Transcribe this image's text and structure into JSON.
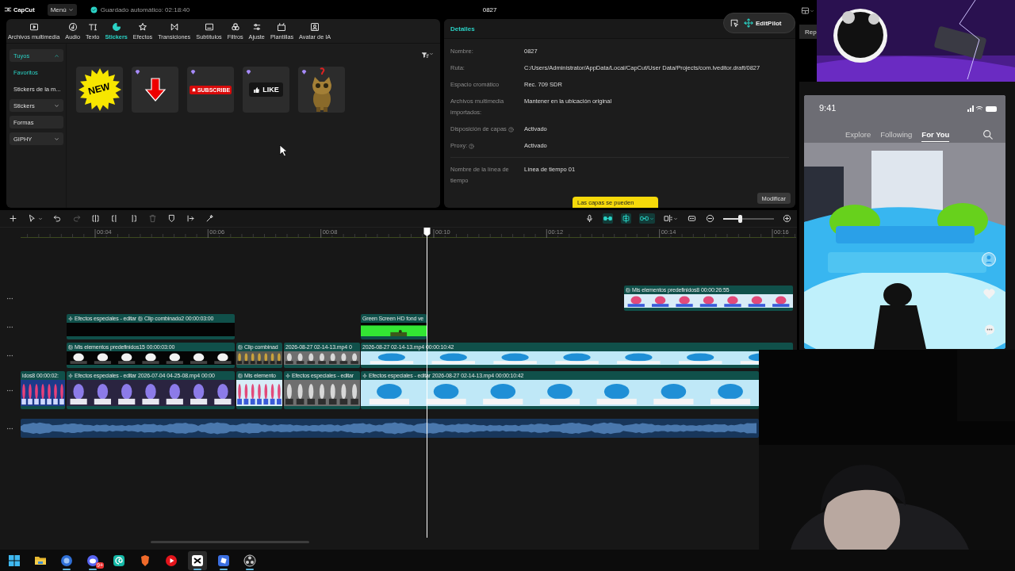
{
  "app": {
    "logo": "CapCut",
    "menu": "Menú",
    "autosave": "Guardado automático: 02:18:40",
    "title": "0827"
  },
  "tabs": [
    {
      "label": "Archivos multimedia",
      "selected": false
    },
    {
      "label": "Audio",
      "selected": false
    },
    {
      "label": "Texto",
      "selected": false
    },
    {
      "label": "Stickers",
      "selected": true
    },
    {
      "label": "Efectos",
      "selected": false
    },
    {
      "label": "Transiciones",
      "selected": false
    },
    {
      "label": "Subtítulos",
      "selected": false
    },
    {
      "label": "Filtros",
      "selected": false
    },
    {
      "label": "Ajuste",
      "selected": false
    },
    {
      "label": "Plantillas",
      "selected": false
    },
    {
      "label": "Avatar de IA",
      "selected": false
    }
  ],
  "sidebar": {
    "items": [
      {
        "kind": "group",
        "label": "Tuyos",
        "selected": true,
        "expanded": true,
        "children": [
          {
            "label": "Favoritos",
            "selected": true
          },
          {
            "label": "Stickers de la m...",
            "selected": false
          }
        ]
      },
      {
        "kind": "group",
        "label": "Stickers",
        "selected": false,
        "expanded": false
      },
      {
        "kind": "plain",
        "label": "Formas",
        "selected": false
      },
      {
        "kind": "group",
        "label": "GIPHY",
        "selected": false,
        "expanded": false
      }
    ]
  },
  "stickers": [
    {
      "kind": "new",
      "text": "NEW",
      "premium": false
    },
    {
      "kind": "arrow",
      "premium": true
    },
    {
      "kind": "subscribe",
      "text": "SUBSCRIBE",
      "premium": true
    },
    {
      "kind": "like",
      "text": "LIKE",
      "premium": true
    },
    {
      "kind": "cat",
      "premium": true
    }
  ],
  "details": {
    "title": "Detalles",
    "rows": [
      {
        "label": "Nombre:",
        "value": "0827",
        "help": false
      },
      {
        "label": "Ruta:",
        "value": "C:/Users/Administrator/AppData/Local/CapCut/User Data/Projects/com.lveditor.draft/0827",
        "help": false
      },
      {
        "label": "Espacio cromático",
        "value": "Rec. 709 SDR",
        "help": false
      },
      {
        "label": "Archivos multimedia importados:",
        "value": "Mantener en la ubicación original",
        "help": false
      },
      {
        "label": "Disposición de capas",
        "value": "Activado",
        "help": true
      },
      {
        "label": "Proxy:",
        "value": "Activado",
        "help": true
      }
    ],
    "timeline_rows": [
      {
        "label": "Nombre de la línea de tiempo",
        "value": "Línea de tiempo 01",
        "help": false
      }
    ],
    "button": "Modificar",
    "tooltip": "Las capas se pueden"
  },
  "editpilot": {
    "label": "EditPilot"
  },
  "timeline": {
    "tools": [
      {
        "kind": "add",
        "disabled": false
      },
      {
        "kind": "select",
        "disabled": false
      },
      {
        "kind": "undo",
        "disabled": false
      },
      {
        "kind": "redo",
        "disabled": true
      },
      {
        "kind": "split",
        "disabled": false
      },
      {
        "kind": "trim-left",
        "disabled": false
      },
      {
        "kind": "trim-right",
        "disabled": false
      },
      {
        "kind": "delete",
        "disabled": true
      },
      {
        "kind": "marker",
        "disabled": false
      },
      {
        "kind": "freeze",
        "disabled": false
      },
      {
        "kind": "auto",
        "disabled": false
      }
    ],
    "view_tools": [
      {
        "kind": "record",
        "on": false
      },
      {
        "kind": "link",
        "on": true
      },
      {
        "kind": "snap",
        "on": true
      },
      {
        "kind": "linkage",
        "on": true
      },
      {
        "kind": "preview",
        "on": false
      },
      {
        "kind": "captions",
        "on": false
      }
    ],
    "zoom": {
      "level": 0.33
    },
    "ruler": [
      "00:04",
      "00:06",
      "00:08",
      "00:10",
      "00:12",
      "00:14",
      "00:16"
    ],
    "tracks": [
      {
        "kind": "overlay",
        "clips": [
          {
            "kind": "video",
            "head": [
              {
                "kind": "compound",
                "text": "Mis elementos predefinidos8"
              },
              {
                "kind": "time",
                "text": "00:00:26:55"
              }
            ]
          }
        ]
      },
      {
        "kind": "overlay",
        "clips": [
          {
            "kind": "black",
            "head": [
              {
                "kind": "effect",
                "text": "Efectos especiales - editar"
              },
              {
                "kind": "compound",
                "text": "Clip combinado2"
              },
              {
                "kind": "time",
                "text": "00:00:03:00"
              }
            ]
          },
          {
            "kind": "green",
            "head": [
              {
                "kind": "name",
                "text": "Green Screen HD fond ve"
              }
            ]
          }
        ]
      },
      {
        "kind": "overlay",
        "clips": [
          {
            "kind": "video",
            "head": [
              {
                "kind": "compound",
                "text": "Mis elementos predefinidos15"
              },
              {
                "kind": "time",
                "text": "00:00:03:00"
              }
            ]
          },
          {
            "kind": "video",
            "head": [
              {
                "kind": "compound",
                "text": "Clip combinad"
              }
            ]
          },
          {
            "kind": "video",
            "head": [
              {
                "kind": "name",
                "text": "2026-08-27 02-14-13.mp4"
              },
              {
                "kind": "time",
                "text": "0"
              }
            ]
          },
          {
            "kind": "video",
            "head": [
              {
                "kind": "name",
                "text": "2026-08-27 02-14-13.mp4"
              },
              {
                "kind": "time",
                "text": "00:00:10:42"
              }
            ]
          }
        ]
      },
      {
        "kind": "main",
        "clips": [
          {
            "kind": "video",
            "head": [
              {
                "kind": "name",
                "text": "idos8"
              },
              {
                "kind": "time",
                "text": "00:00:02:"
              }
            ]
          },
          {
            "kind": "video",
            "head": [
              {
                "kind": "effect",
                "text": "Efectos especiales - editar"
              },
              {
                "kind": "name",
                "text": "2026-07-04 04-25-08.mp4"
              },
              {
                "kind": "time",
                "text": "00:00"
              }
            ]
          },
          {
            "kind": "video",
            "head": [
              {
                "kind": "compound",
                "text": "Mis elemento"
              }
            ]
          },
          {
            "kind": "video",
            "head": [
              {
                "kind": "effect",
                "text": "Efectos especiales - editar"
              }
            ]
          },
          {
            "kind": "video",
            "head": [
              {
                "kind": "effect",
                "text": "Efectos especiales - editar"
              },
              {
                "kind": "name",
                "text": "2026-08-27 02-14-13.mp4"
              },
              {
                "kind": "time",
                "text": "00:00:10:42"
              }
            ]
          }
        ]
      },
      {
        "kind": "audio",
        "clips": [
          {
            "kind": "audio"
          }
        ]
      }
    ]
  },
  "side": {
    "button": "Rep",
    "phone": {
      "time": "9:41",
      "tabs": [
        {
          "label": "Explore",
          "selected": false
        },
        {
          "label": "Following",
          "selected": false
        },
        {
          "label": "For You",
          "selected": true
        }
      ]
    }
  },
  "taskbar": {
    "apps": [
      {
        "kind": "start",
        "selected": false,
        "running": false
      },
      {
        "kind": "folder",
        "selected": false,
        "running": false
      },
      {
        "kind": "browser",
        "selected": false,
        "running": true
      },
      {
        "kind": "chat",
        "selected": false,
        "running": true,
        "badge": "9+"
      },
      {
        "kind": "notes",
        "selected": false,
        "running": false
      },
      {
        "kind": "shield",
        "selected": false,
        "running": false
      },
      {
        "kind": "music",
        "selected": false,
        "running": false
      },
      {
        "kind": "editor",
        "selected": true,
        "running": true
      },
      {
        "kind": "game",
        "selected": false,
        "running": true
      },
      {
        "kind": "recorder",
        "selected": false,
        "running": true
      }
    ]
  }
}
